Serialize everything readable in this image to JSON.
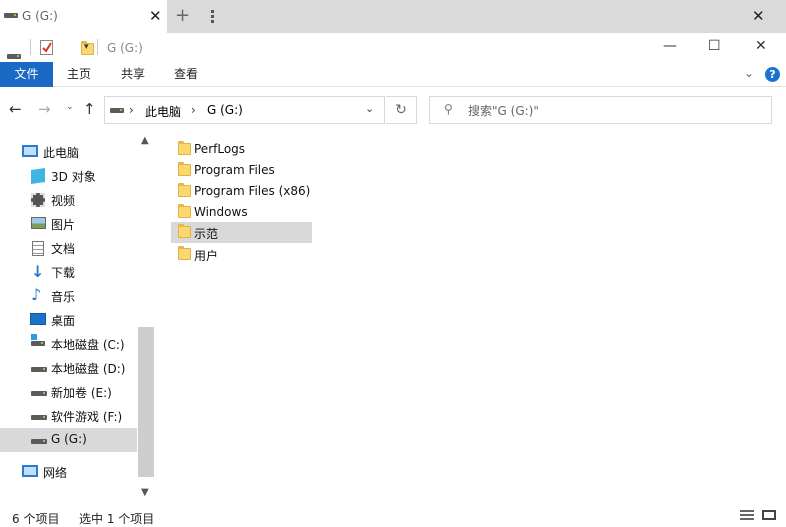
{
  "window": {
    "tab_title": "G (G:)",
    "title": "G (G:)",
    "tab_close": "✕",
    "new_tab": "+",
    "close_all": "✕"
  },
  "window_controls": {
    "minimize": "—",
    "maximize": "☐",
    "close": "✕"
  },
  "ribbon": {
    "file": "文件",
    "tabs": [
      "主页",
      "共享",
      "查看"
    ],
    "help": "?"
  },
  "address": {
    "crumbs": [
      "此电脑",
      "G (G:)"
    ],
    "separator": "›",
    "refresh": "↻"
  },
  "search": {
    "placeholder": "搜索\"G (G:)\""
  },
  "nav": {
    "items": [
      {
        "label": "此电脑",
        "icon": "pc-icon"
      },
      {
        "label": "3D 对象",
        "icon": "3d-objects-icon"
      },
      {
        "label": "视频",
        "icon": "video-icon"
      },
      {
        "label": "图片",
        "icon": "pictures-icon"
      },
      {
        "label": "文档",
        "icon": "documents-icon"
      },
      {
        "label": "下载",
        "icon": "download-icon"
      },
      {
        "label": "音乐",
        "icon": "music-icon"
      },
      {
        "label": "桌面",
        "icon": "desktop-icon"
      },
      {
        "label": "本地磁盘 (C:)",
        "icon": "system-drive-icon"
      },
      {
        "label": "本地磁盘 (D:)",
        "icon": "drive-icon"
      },
      {
        "label": "新加卷 (E:)",
        "icon": "drive-icon"
      },
      {
        "label": "软件游戏 (F:)",
        "icon": "drive-icon"
      },
      {
        "label": "G (G:)",
        "icon": "drive-icon",
        "selected": true
      },
      {
        "label": "网络",
        "icon": "network-icon"
      }
    ]
  },
  "files": [
    {
      "name": "PerfLogs"
    },
    {
      "name": "Program Files"
    },
    {
      "name": "Program Files (x86)"
    },
    {
      "name": "Windows"
    },
    {
      "name": "示范",
      "selected": true
    },
    {
      "name": "用户"
    }
  ],
  "status": {
    "count": "6 个项目",
    "selection": "选中 1 个项目"
  },
  "colors": {
    "accent": "#1a6ac5",
    "selection": "#d9d9d9",
    "folder": "#fcd66e"
  }
}
